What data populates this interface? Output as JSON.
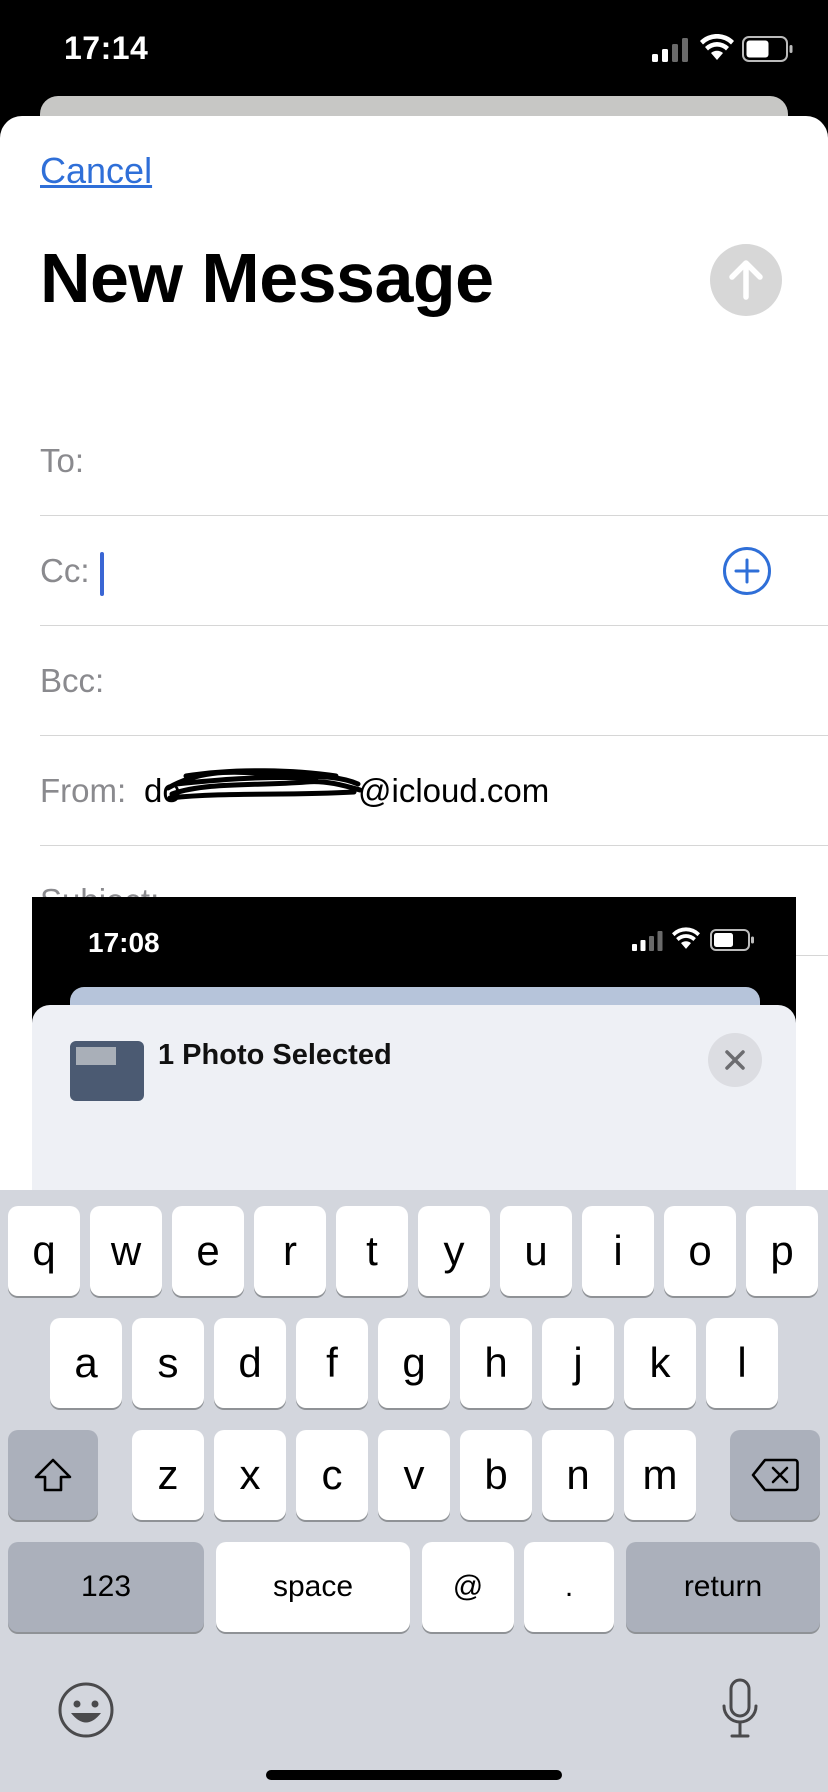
{
  "status_bar": {
    "time": "17:14"
  },
  "compose": {
    "cancel_label": "Cancel",
    "title": "New Message",
    "fields": {
      "to_label": "To:",
      "cc_label": "Cc:",
      "bcc_label": "Bcc:",
      "from_label": "From:",
      "from_value": "do",
      "from_domain": "@icloud.com",
      "subject_label": "Subject:"
    }
  },
  "attachment": {
    "time": "17:08",
    "title": "1 Photo Selected"
  },
  "keyboard": {
    "row1": [
      "q",
      "w",
      "e",
      "r",
      "t",
      "y",
      "u",
      "i",
      "o",
      "p"
    ],
    "row2": [
      "a",
      "s",
      "d",
      "f",
      "g",
      "h",
      "j",
      "k",
      "l"
    ],
    "row3": [
      "z",
      "x",
      "c",
      "v",
      "b",
      "n",
      "m"
    ],
    "numbers_label": "123",
    "space_label": "space",
    "at_label": "@",
    "dot_label": ".",
    "return_label": "return"
  },
  "colors": {
    "accent": "#2f6fd8",
    "keyboard_bg": "#d3d6dd",
    "key_dark": "#abb0bb"
  },
  "icons": [
    "signal-icon",
    "wifi-icon",
    "battery-icon",
    "send-arrow-icon",
    "add-contact-icon",
    "close-icon",
    "shift-icon",
    "backspace-icon",
    "emoji-icon",
    "microphone-icon"
  ]
}
